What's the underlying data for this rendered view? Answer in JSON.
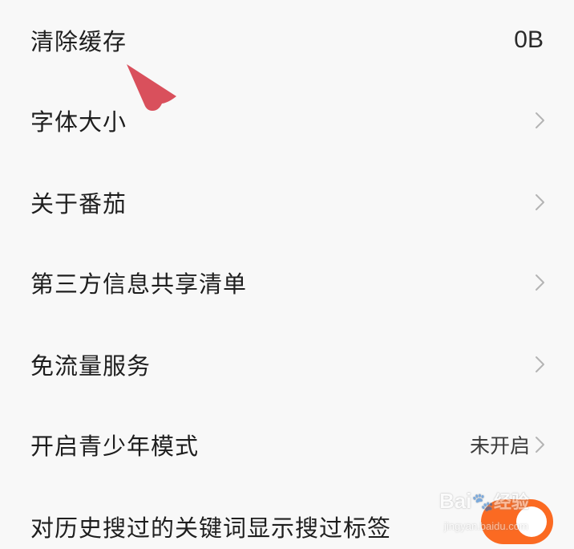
{
  "settings": {
    "items": [
      {
        "label": "清除缓存",
        "value": "0B"
      },
      {
        "label": "字体大小"
      },
      {
        "label": "关于番茄"
      },
      {
        "label": "第三方信息共享清单"
      },
      {
        "label": "免流量服务"
      },
      {
        "label": "开启青少年模式",
        "value": "未开启"
      },
      {
        "label": "对历史搜过的关键词显示搜过标签",
        "toggle_on": true
      }
    ]
  },
  "colors": {
    "toggle_on": "#fb6a22",
    "cursor": "#d9505c",
    "background": "#f8f8f8"
  },
  "icons": {
    "chevron": "chevron-right-icon",
    "cursor": "pointer-arrow-icon"
  },
  "watermark": {
    "brand": "Bai",
    "brand_suffix": "经验",
    "url": "jingyan.baidu.com"
  }
}
